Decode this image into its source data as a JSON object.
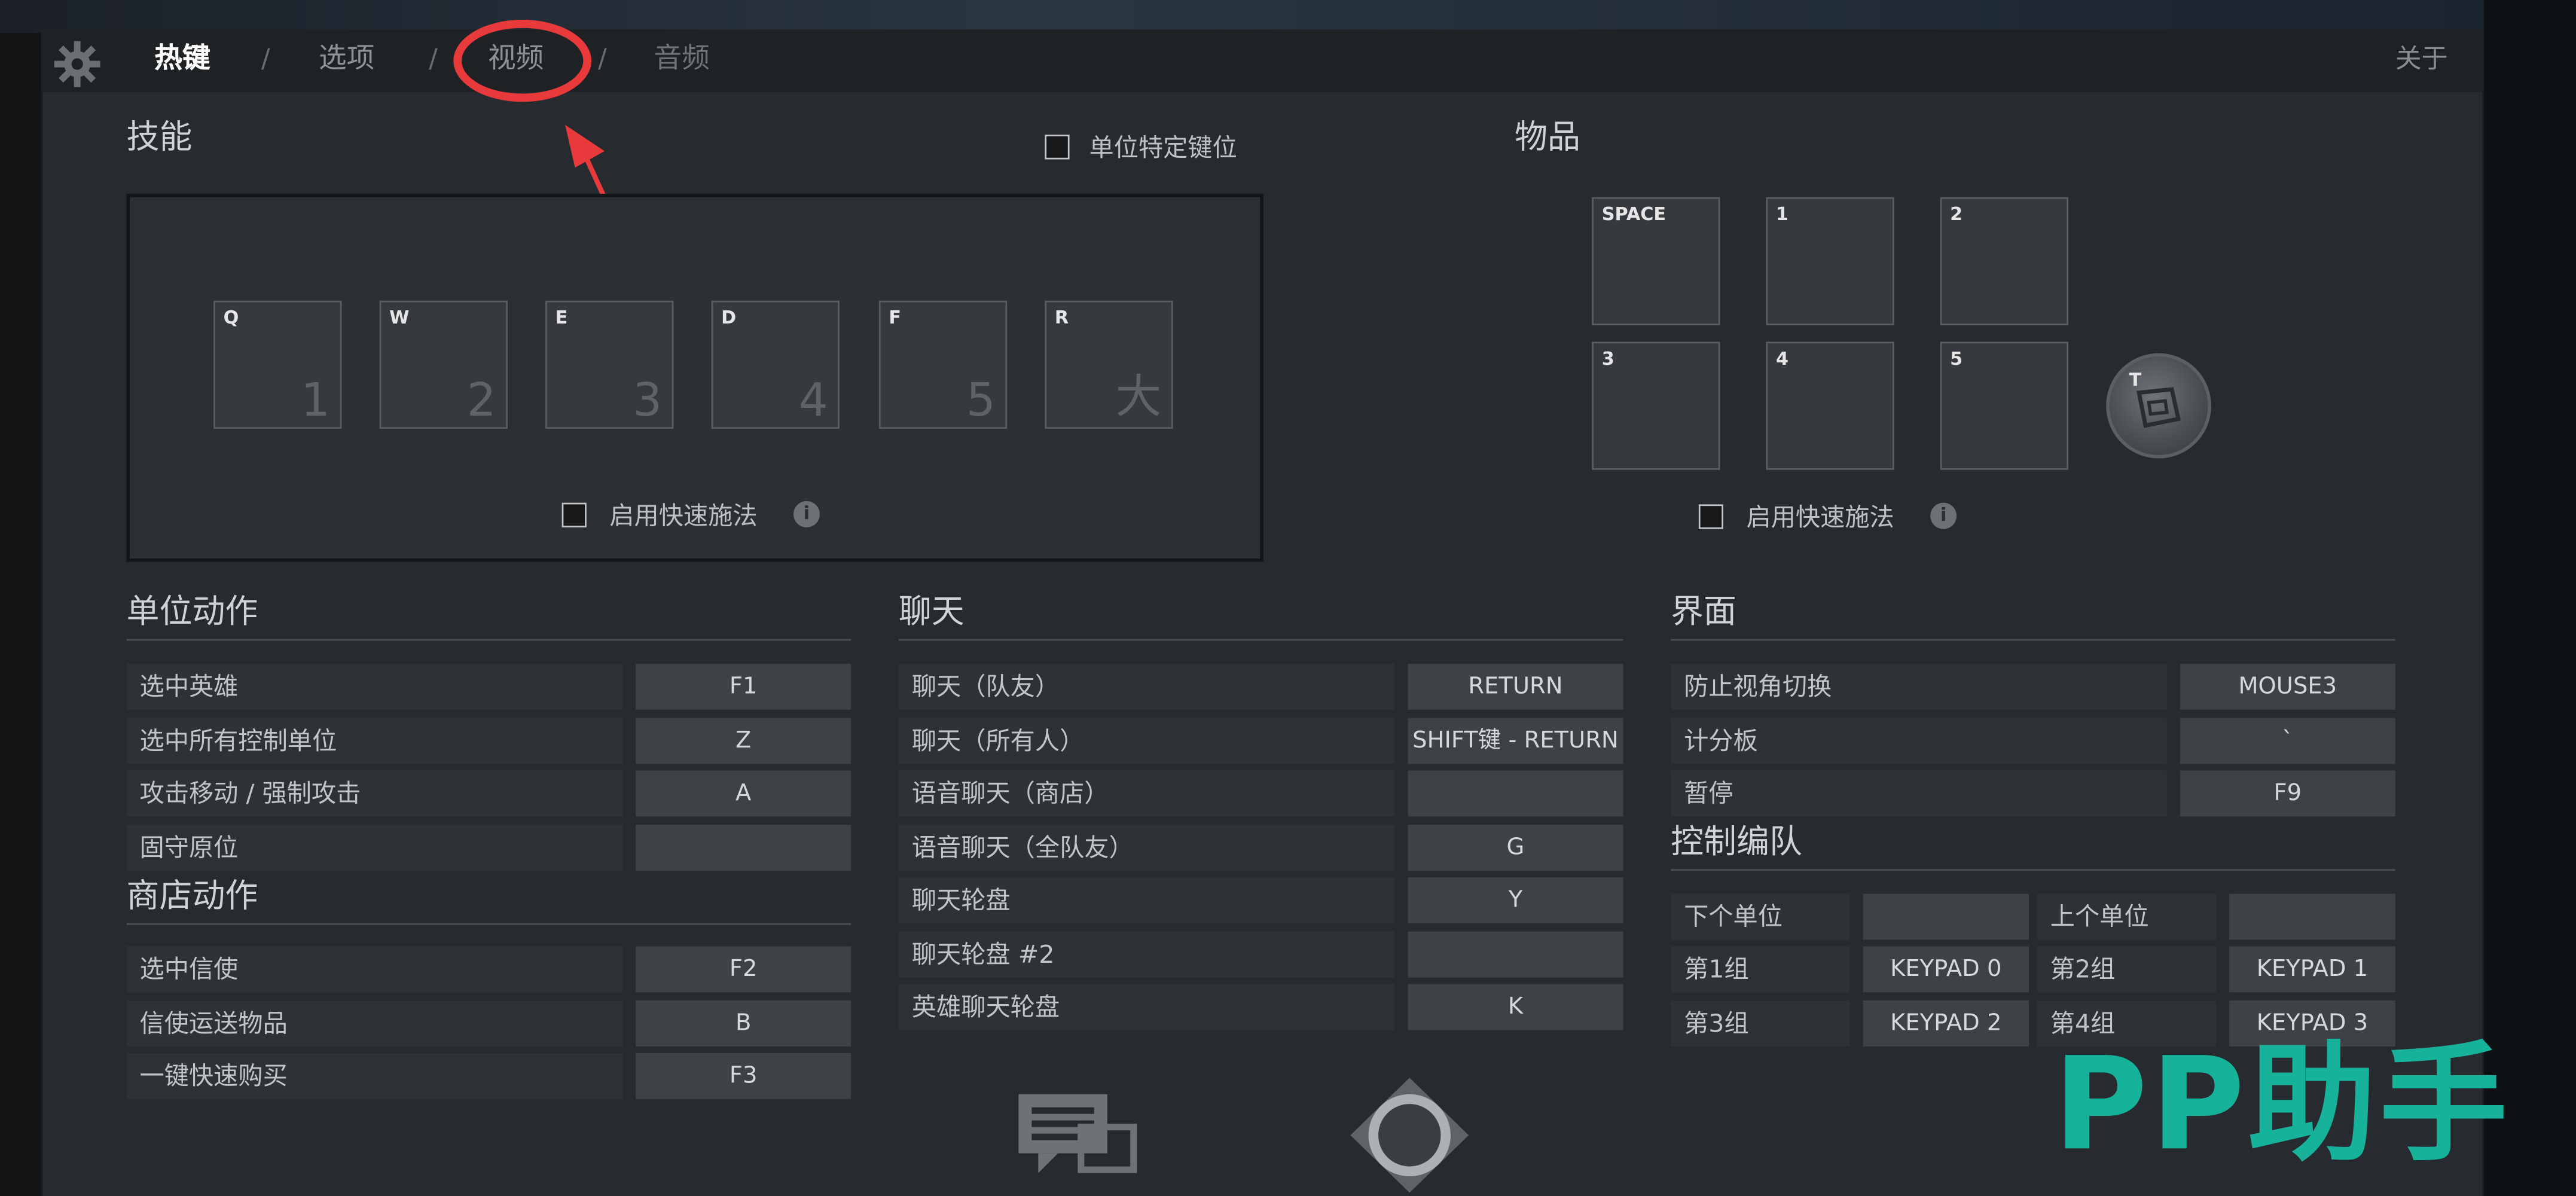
{
  "nav": {
    "tabs": [
      "热键",
      "选项",
      "视频",
      "音频"
    ],
    "separator": "/",
    "about": "关于"
  },
  "abilities": {
    "title": "技能",
    "unit_specific_label": "单位特定键位",
    "slots": [
      {
        "key": "Q",
        "glyph": "1"
      },
      {
        "key": "W",
        "glyph": "2"
      },
      {
        "key": "E",
        "glyph": "3"
      },
      {
        "key": "D",
        "glyph": "4"
      },
      {
        "key": "F",
        "glyph": "5"
      },
      {
        "key": "R",
        "glyph": "大"
      }
    ],
    "quickcast_label": "启用快速施法"
  },
  "items": {
    "title": "物品",
    "slots": [
      "SPACE",
      "1",
      "2",
      "3",
      "4",
      "5"
    ],
    "tp_key": "T",
    "quickcast_label": "启用快速施法"
  },
  "unit_actions": {
    "title": "单位动作",
    "rows": [
      {
        "label": "选中英雄",
        "value": "F1"
      },
      {
        "label": "选中所有控制单位",
        "value": "Z"
      },
      {
        "label": "攻击移动 / 强制攻击",
        "value": "A"
      },
      {
        "label": "固守原位",
        "value": ""
      }
    ]
  },
  "shop_actions": {
    "title": "商店动作",
    "rows": [
      {
        "label": "选中信使",
        "value": "F2"
      },
      {
        "label": "信使运送物品",
        "value": "B"
      },
      {
        "label": "一键快速购买",
        "value": "F3"
      }
    ]
  },
  "chat": {
    "title": "聊天",
    "rows": [
      {
        "label": "聊天（队友）",
        "value": "RETURN"
      },
      {
        "label": "聊天（所有人）",
        "value": "SHIFT键 - RETURN"
      },
      {
        "label": "语音聊天（商店）",
        "value": ""
      },
      {
        "label": "语音聊天（全队友）",
        "value": "G"
      },
      {
        "label": "聊天轮盘",
        "value": "Y"
      },
      {
        "label": "聊天轮盘 #2",
        "value": ""
      },
      {
        "label": "英雄聊天轮盘",
        "value": "K"
      }
    ]
  },
  "interface": {
    "title": "界面",
    "rows": [
      {
        "label": "防止视角切换",
        "value": "MOUSE3"
      },
      {
        "label": "计分板",
        "value": "`"
      },
      {
        "label": "暂停",
        "value": "F9"
      }
    ]
  },
  "control_groups": {
    "title": "控制编队",
    "pairs": [
      [
        {
          "label": "下个单位",
          "value": ""
        },
        {
          "label": "上个单位",
          "value": ""
        }
      ],
      [
        {
          "label": "第1组",
          "value": "KEYPAD 0"
        },
        {
          "label": "第2组",
          "value": "KEYPAD 1"
        }
      ],
      [
        {
          "label": "第3组",
          "value": "KEYPAD 2"
        },
        {
          "label": "第4组",
          "value": "KEYPAD 3"
        }
      ]
    ]
  },
  "watermark": "PP助手",
  "colors": {
    "annotation": "#e83a3a",
    "watermark": "#17b29a"
  }
}
